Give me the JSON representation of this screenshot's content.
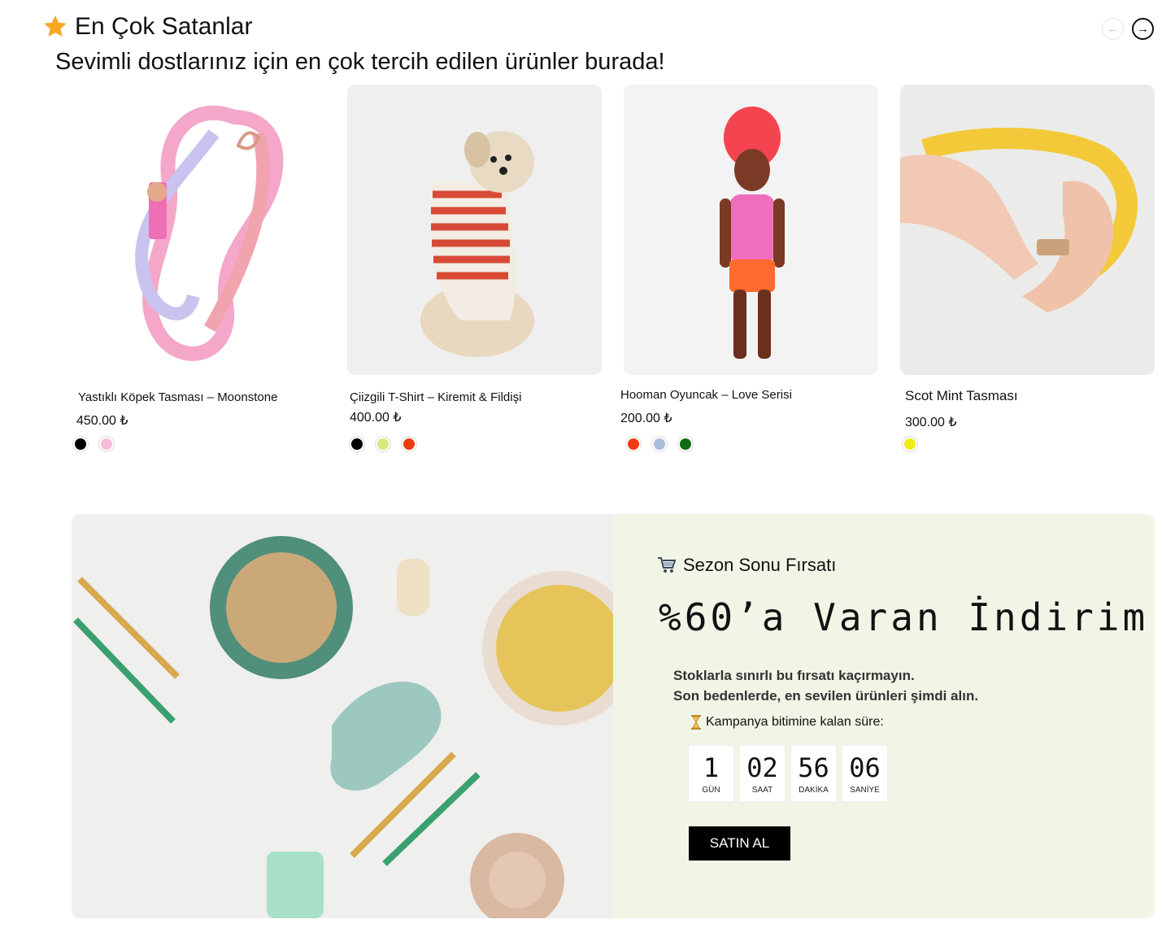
{
  "section": {
    "title": "En Çok Satanlar",
    "subtitle": "Sevimli dostlarınız için en çok tercih edilen ürünler burada!",
    "prev_icon": "arrow-left-icon",
    "next_icon": "arrow-right-icon"
  },
  "products": [
    {
      "name": "Yastıklı Köpek Tasması – Moonstone",
      "price": "450.00 ₺",
      "swatches": [
        "#000000",
        "#f7bdd8"
      ]
    },
    {
      "name": "Çiizgili T-Shirt – Kiremit & Fildişi",
      "price": "400.00 ₺",
      "swatches": [
        "#000000",
        "#d9e87a",
        "#f03a10"
      ]
    },
    {
      "name": "Hooman Oyuncak – Love Serisi",
      "price": "200.00 ₺",
      "swatches": [
        "#f03a10",
        "#a9bddc",
        "#0f6b16"
      ]
    },
    {
      "name": "Scot Mint Tasması",
      "price": "300.00 ₺",
      "swatches": [
        "#f2ea1a"
      ]
    }
  ],
  "promo": {
    "tag": "Sezon Sonu Fırsatı",
    "tag_icon": "shopping-cart-icon",
    "title": "%60’a Varan İndirim!",
    "desc_line1": "Stoklarla sınırlı bu fırsatı kaçırmayın.",
    "desc_line2": "Son bedenlerde, en sevilen ürünleri şimdi alın.",
    "timer_label": "Kampanya bitimine kalan süre:",
    "timer_icon": "hourglass-icon",
    "timer": [
      {
        "value": "1",
        "label": "GÜN"
      },
      {
        "value": "02",
        "label": "SAAT"
      },
      {
        "value": "56",
        "label": "DAKİKA"
      },
      {
        "value": "06",
        "label": "SANİYE"
      }
    ],
    "button": "SATIN AL"
  },
  "colors": {
    "star": "#f7a823",
    "promo_bg": "#f1f5e6",
    "button_bg": "#000000"
  }
}
